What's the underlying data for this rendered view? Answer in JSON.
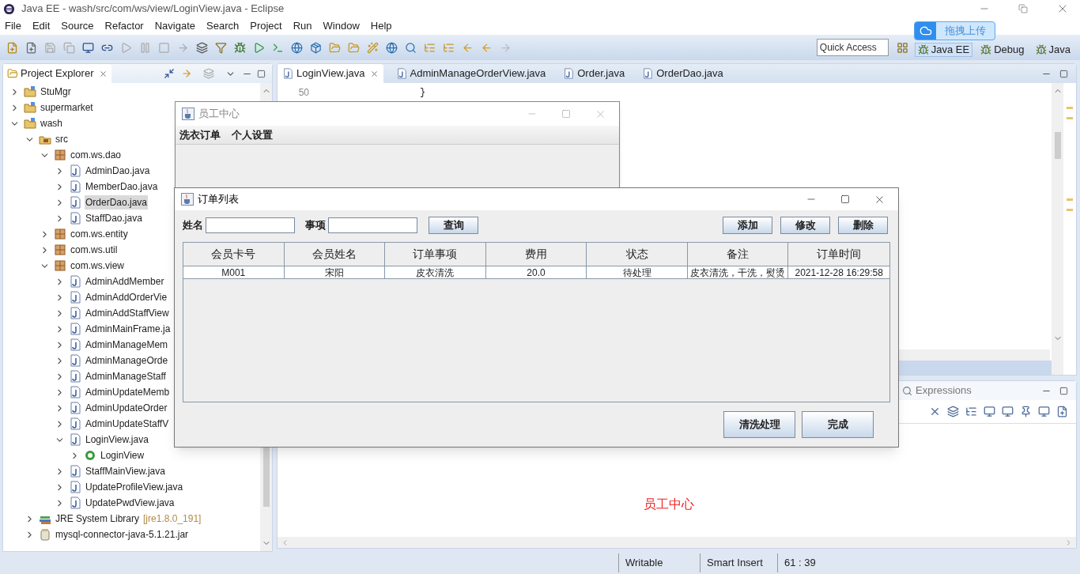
{
  "window": {
    "title": "Java EE - wash/src/com/ws/view/LoginView.java - Eclipse"
  },
  "menu": [
    "File",
    "Edit",
    "Source",
    "Refactor",
    "Navigate",
    "Search",
    "Project",
    "Run",
    "Window",
    "Help"
  ],
  "quick_access": {
    "placeholder": "Quick Access"
  },
  "perspectives": [
    {
      "label": "Java EE",
      "selected": true
    },
    {
      "label": "Debug",
      "selected": false
    },
    {
      "label": "Java",
      "selected": false
    }
  ],
  "upload_badge": {
    "label": "拖拽上传"
  },
  "explorer": {
    "title": "Project Explorer",
    "tree": [
      {
        "label": "StuMgr",
        "kind": "project",
        "expanded": false,
        "selected": false
      },
      {
        "label": "supermarket",
        "kind": "project",
        "expanded": false,
        "selected": false
      },
      {
        "label": "wash",
        "kind": "project",
        "expanded": true,
        "selected": false,
        "children": [
          {
            "label": "src",
            "kind": "folder",
            "expanded": true,
            "selected": false,
            "children": [
              {
                "label": "com.ws.dao",
                "kind": "package",
                "expanded": true,
                "selected": false,
                "children": [
                  {
                    "label": "AdminDao.java",
                    "kind": "file",
                    "expanded": false,
                    "selected": false
                  },
                  {
                    "label": "MemberDao.java",
                    "kind": "file",
                    "expanded": false,
                    "selected": false
                  },
                  {
                    "label": "OrderDao.java",
                    "kind": "file",
                    "expanded": false,
                    "selected": true
                  },
                  {
                    "label": "StaffDao.java",
                    "kind": "file",
                    "expanded": false,
                    "selected": false
                  }
                ]
              },
              {
                "label": "com.ws.entity",
                "kind": "package",
                "expanded": false,
                "selected": false
              },
              {
                "label": "com.ws.util",
                "kind": "package",
                "expanded": false,
                "selected": false
              },
              {
                "label": "com.ws.view",
                "kind": "package",
                "expanded": true,
                "selected": false,
                "children": [
                  {
                    "label": "AdminAddMember",
                    "kind": "file",
                    "expanded": false,
                    "selected": false
                  },
                  {
                    "label": "AdminAddOrderVie",
                    "kind": "file",
                    "expanded": false,
                    "selected": false
                  },
                  {
                    "label": "AdminAddStaffView",
                    "kind": "file",
                    "expanded": false,
                    "selected": false
                  },
                  {
                    "label": "AdminMainFrame.ja",
                    "kind": "file",
                    "expanded": false,
                    "selected": false
                  },
                  {
                    "label": "AdminManageMem",
                    "kind": "file",
                    "expanded": false,
                    "selected": false
                  },
                  {
                    "label": "AdminManageOrde",
                    "kind": "file",
                    "expanded": false,
                    "selected": false
                  },
                  {
                    "label": "AdminManageStaff",
                    "kind": "file",
                    "expanded": false,
                    "selected": false
                  },
                  {
                    "label": "AdminUpdateMemb",
                    "kind": "file",
                    "expanded": false,
                    "selected": false
                  },
                  {
                    "label": "AdminUpdateOrder",
                    "kind": "file",
                    "expanded": false,
                    "selected": false
                  },
                  {
                    "label": "AdminUpdateStaffV",
                    "kind": "file",
                    "expanded": false,
                    "selected": false
                  },
                  {
                    "label": "LoginView.java",
                    "kind": "file",
                    "expanded": true,
                    "selected": false,
                    "children": [
                      {
                        "label": "LoginView",
                        "kind": "class",
                        "expanded": false,
                        "selected": false
                      }
                    ]
                  },
                  {
                    "label": "StaffMainView.java",
                    "kind": "file",
                    "expanded": false,
                    "selected": false
                  },
                  {
                    "label": "UpdateProfileView.java",
                    "kind": "file",
                    "expanded": false,
                    "selected": false
                  },
                  {
                    "label": "UpdatePwdView.java",
                    "kind": "file",
                    "expanded": false,
                    "selected": false
                  }
                ]
              }
            ]
          },
          {
            "label": "JRE System Library",
            "decoration": "[jre1.8.0_191]",
            "kind": "library",
            "expanded": false,
            "selected": false
          },
          {
            "label": "mysql-connector-java-5.1.21.jar",
            "kind": "jar",
            "expanded": false,
            "selected": false
          }
        ]
      }
    ]
  },
  "editor": {
    "tabs": [
      {
        "label": "LoginView.java",
        "selected": true
      },
      {
        "label": "AdminManageOrderView.java",
        "selected": false
      },
      {
        "label": "Order.java",
        "selected": false
      },
      {
        "label": "OrderDao.java",
        "selected": false
      }
    ],
    "line_number": "50",
    "code": "}"
  },
  "lower_panel": {
    "tab": "Expressions",
    "preview_text": "员工中心"
  },
  "status_bar": [
    "Writable",
    "Smart Insert",
    "61 : 39"
  ],
  "staff_window": {
    "title": "员工中心",
    "menu": [
      "洗衣订单",
      "个人设置"
    ]
  },
  "order_window": {
    "title": "订单列表",
    "filters": [
      {
        "label": "姓名"
      },
      {
        "label": "事项"
      }
    ],
    "search_button": "查询",
    "actions": [
      "添加",
      "修改",
      "删除"
    ],
    "table": {
      "columns": [
        "会员卡号",
        "会员姓名",
        "订单事项",
        "费用",
        "状态",
        "备注",
        "订单时间"
      ],
      "rows": [
        [
          "M001",
          "宋阳",
          "皮衣清洗",
          "20.0",
          "待处理",
          "皮衣清洗，干洗，熨烫",
          "2021-12-28 16:29:58"
        ]
      ]
    },
    "bottom_buttons": [
      "清洗处理",
      "完成"
    ]
  }
}
